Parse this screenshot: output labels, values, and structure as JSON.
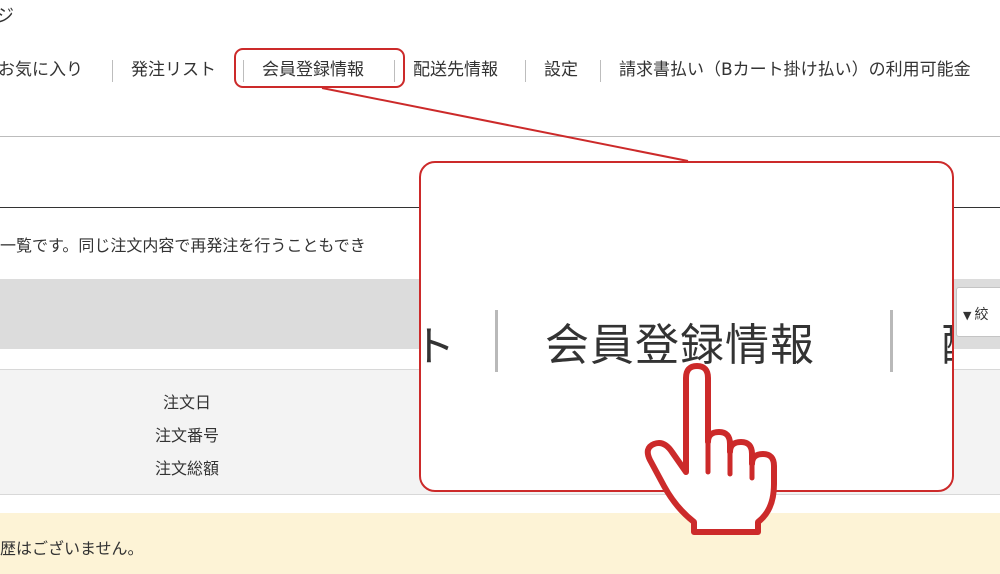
{
  "top_fragment": "ジ",
  "nav": {
    "favorites": "お気に入り",
    "order_list": "発注リスト",
    "member_info": "会員登録情報",
    "shipping": "配送先情報",
    "settings": "設定",
    "invoice": "請求書払い（Bカート掛け払い）の利用可能金"
  },
  "description": "一覧です。同じ注文内容で再発注を行うこともでき",
  "dropdown_label": "絞",
  "table_header": {
    "order_date": "注文日",
    "order_number": "注文番号",
    "order_total": "注文総額"
  },
  "empty_notice": "歴はございません。",
  "callout": {
    "zoom_label": "会員登録情報",
    "left_fragment": "ト",
    "right_fragment": "配"
  },
  "colors": {
    "accent_red": "#cc2a2a",
    "notice_bg": "#fdf3d6",
    "bar_gray": "#dcdcdc"
  }
}
